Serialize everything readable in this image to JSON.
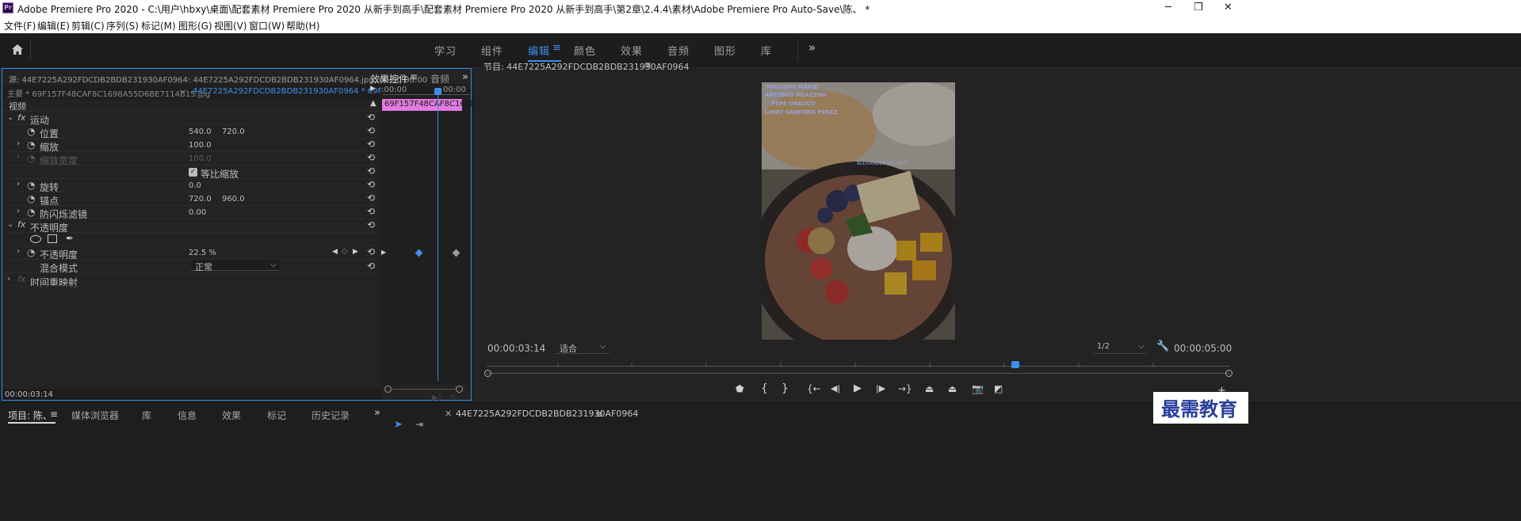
{
  "window": {
    "app_icon": "Pr",
    "title": "Adobe Premiere Pro 2020 - C:\\用户\\hbxy\\桌面\\配套素材 Premiere Pro 2020 从新手到高手\\配套素材 Premiere Pro 2020 从新手到高手\\第2章\\2.4.4\\素材\\Adobe Premiere Pro Auto-Save\\陈、 *",
    "minimize": "─",
    "maximize": "❐",
    "close": "✕"
  },
  "menu": [
    "文件(F)",
    "编辑(E)",
    "剪辑(C)",
    "序列(S)",
    "标记(M)",
    "图形(G)",
    "视图(V)",
    "窗口(W)",
    "帮助(H)"
  ],
  "workspaces": {
    "items": [
      "学习",
      "组件",
      "编辑",
      "颜色",
      "效果",
      "音频",
      "图形",
      "库"
    ],
    "active": "编辑",
    "menu_icon": "≡",
    "more": "»"
  },
  "effect_controls": {
    "source_label": "源: 44E7225A292FDCDB2BDB231930AF0964: 44E7225A292FDCDB2BDB231930AF0964.jpg: 00:00:00:00",
    "tabs": [
      "效果控件",
      "音频"
    ],
    "master_label": "主要 * 69F157F48CAF8C1698A55D6BE7114B15.jpg",
    "sequence_label": "44E7225A292FDCDB2BDB231930AF0964 * 69F15...",
    "timeline_start": ":00:00",
    "timeline_end": "00:00",
    "clip_label": "69F157F48CAF8C1698A",
    "video_header": "视频",
    "motion": "运动",
    "position_label": "位置",
    "position_x": "540.0",
    "position_y": "720.0",
    "scale_label": "缩放",
    "scale_value": "100.0",
    "scale_width_label": "缩放宽度",
    "scale_width_value": "100.0",
    "uniform_scale_label": "等比缩放",
    "rotation_label": "旋转",
    "rotation_value": "0.0",
    "anchor_label": "锚点",
    "anchor_x": "720.0",
    "anchor_y": "960.0",
    "flicker_label": "防闪烁滤镜",
    "flicker_value": "0.00",
    "opacity_header": "不透明度",
    "opacity_label": "不透明度",
    "opacity_value": "22.5 %",
    "blend_label": "混合模式",
    "blend_value": "正常",
    "time_remap": "时间重映射",
    "current_time": "00:00:03:14",
    "fx": "fx"
  },
  "program": {
    "title": "节目: 44E7225A292FDCDB2BDB231930AF0964",
    "menu_icon": "≡",
    "timecode": "00:00:03:14",
    "fit": "适合",
    "resolution": "1/2",
    "duration": "00:00:05:00",
    "image_text": [
      "MALLORY MARIE",
      "ANTONIO MEAZZINI",
      "PEPE OROZCO",
      "LINDY SANFORD PEREZ",
      "ALEXANDER VOCHUS"
    ]
  },
  "bottom": {
    "tabs": [
      "项目: 陈、",
      "媒体浏览器",
      "库",
      "信息",
      "效果",
      "标记",
      "历史记录"
    ],
    "more": "»",
    "sequence_tab": "44E7225A292FDCDB2BDB231930AF0964",
    "watermark": "最需教育"
  },
  "colors": {
    "accent": "#3e8ded",
    "clip": "#e07be0",
    "panel_border": "#2d8ceb",
    "watermark": "#2a3d9c"
  }
}
